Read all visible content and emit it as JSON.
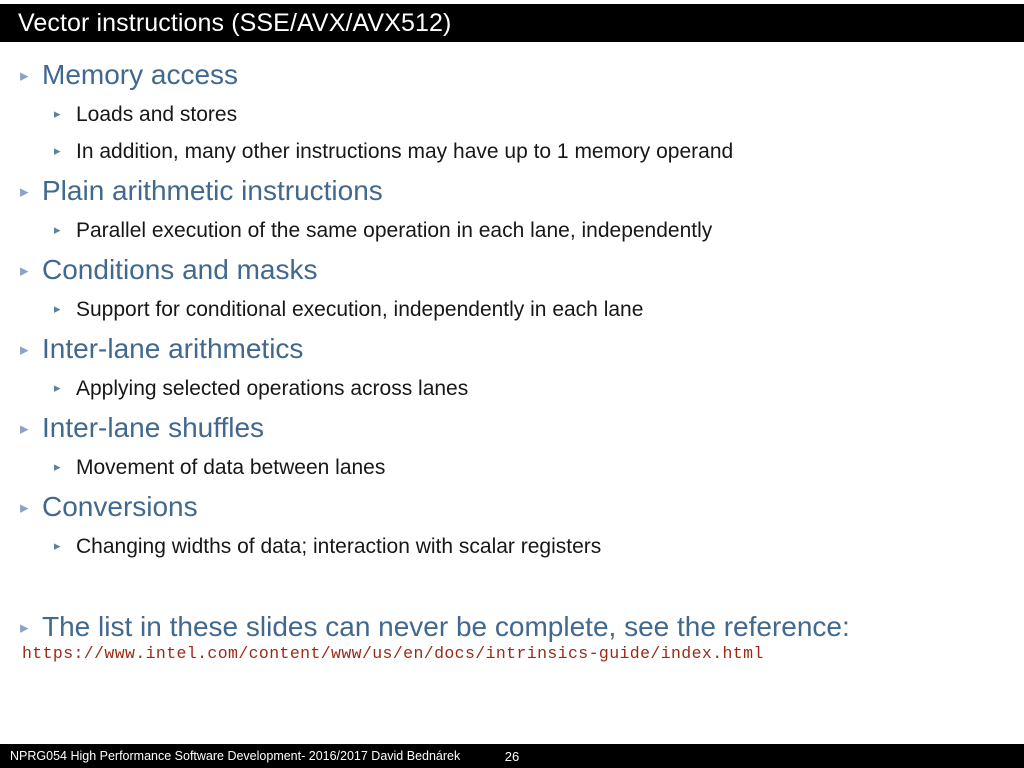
{
  "slide": {
    "title": "Vector instructions (SSE/AVX/AVX512)",
    "bullets": [
      {
        "level": 1,
        "text": "Memory access"
      },
      {
        "level": 2,
        "text": "Loads and stores"
      },
      {
        "level": 2,
        "text": "In addition, many other instructions may have up to 1 memory operand"
      },
      {
        "level": 1,
        "text": "Plain arithmetic instructions"
      },
      {
        "level": 2,
        "text": "Parallel execution of the same operation in each lane, independently"
      },
      {
        "level": 1,
        "text": "Conditions and masks"
      },
      {
        "level": 2,
        "text": "Support for conditional execution, independently in each lane"
      },
      {
        "level": 1,
        "text": "Inter-lane arithmetics"
      },
      {
        "level": 2,
        "text": "Applying selected operations across lanes"
      },
      {
        "level": 1,
        "text": "Inter-lane shuffles"
      },
      {
        "level": 2,
        "text": "Movement of data between lanes"
      },
      {
        "level": 1,
        "text": "Conversions"
      },
      {
        "level": 2,
        "text": "Changing widths of data; interaction with scalar registers"
      },
      {
        "level": 0,
        "text": ""
      },
      {
        "level": 1,
        "text": "The list in these slides can never be complete, see the reference:"
      }
    ],
    "reference_url": "https://www.intel.com/content/www/us/en/docs/intrinsics-guide/index.html",
    "bullet_glyph": "▸"
  },
  "footer": {
    "course": "NPRG054 High Performance Software Development- 2016/2017 David Bednárek",
    "page_number": "26"
  },
  "colors": {
    "title_bar": "#000000",
    "title_text": "#ffffff",
    "level1_text": "#41688e",
    "level2_text": "#171717",
    "url_text": "#9a2a14",
    "bullet_marker": "#8ba3c7"
  }
}
